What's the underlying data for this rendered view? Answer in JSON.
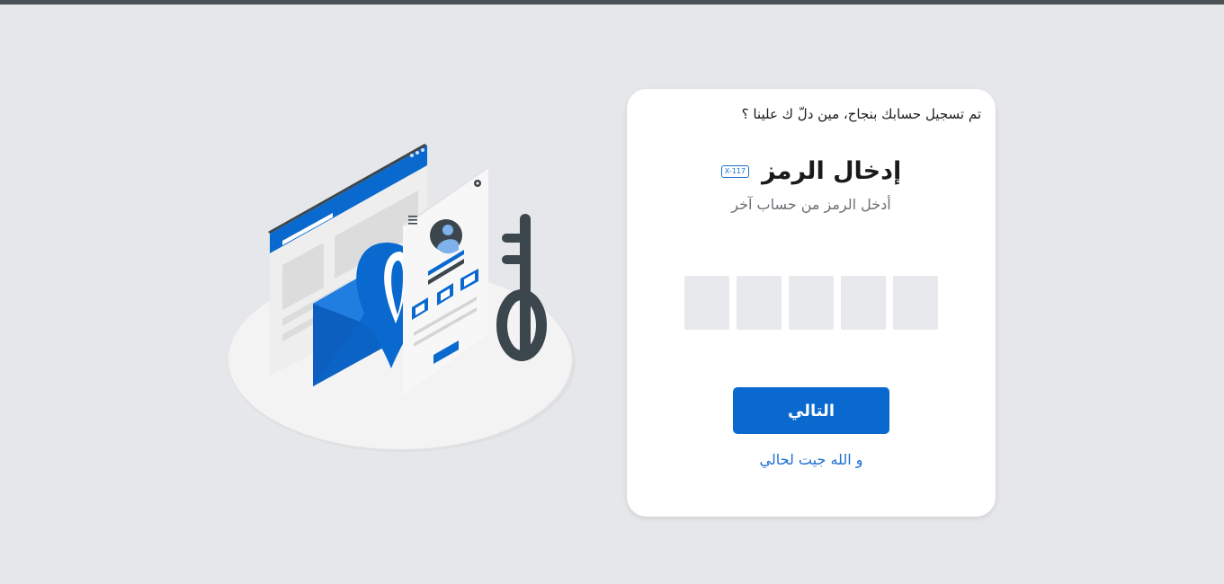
{
  "card": {
    "notice": "تم تسجيل حسابك بنجاح، مين دلّ ك علينا ؟",
    "title": "إدخال الرمز",
    "badge": "X-117",
    "subtitle": "أدخل الرمز من حساب آخر",
    "code_boxes": [
      "",
      "",
      "",
      "",
      ""
    ],
    "next_label": "التالي",
    "link_label": "و الله جيت لحالي"
  },
  "illustration": {
    "icons": [
      "browser-window",
      "envelope",
      "shield-pin",
      "profile-card",
      "gear",
      "menu",
      "key"
    ]
  },
  "colors": {
    "accent": "#0a69cf",
    "page_bg": "#e6e7ea",
    "box_bg": "#e8e9ec",
    "topbar": "#4a5257"
  }
}
